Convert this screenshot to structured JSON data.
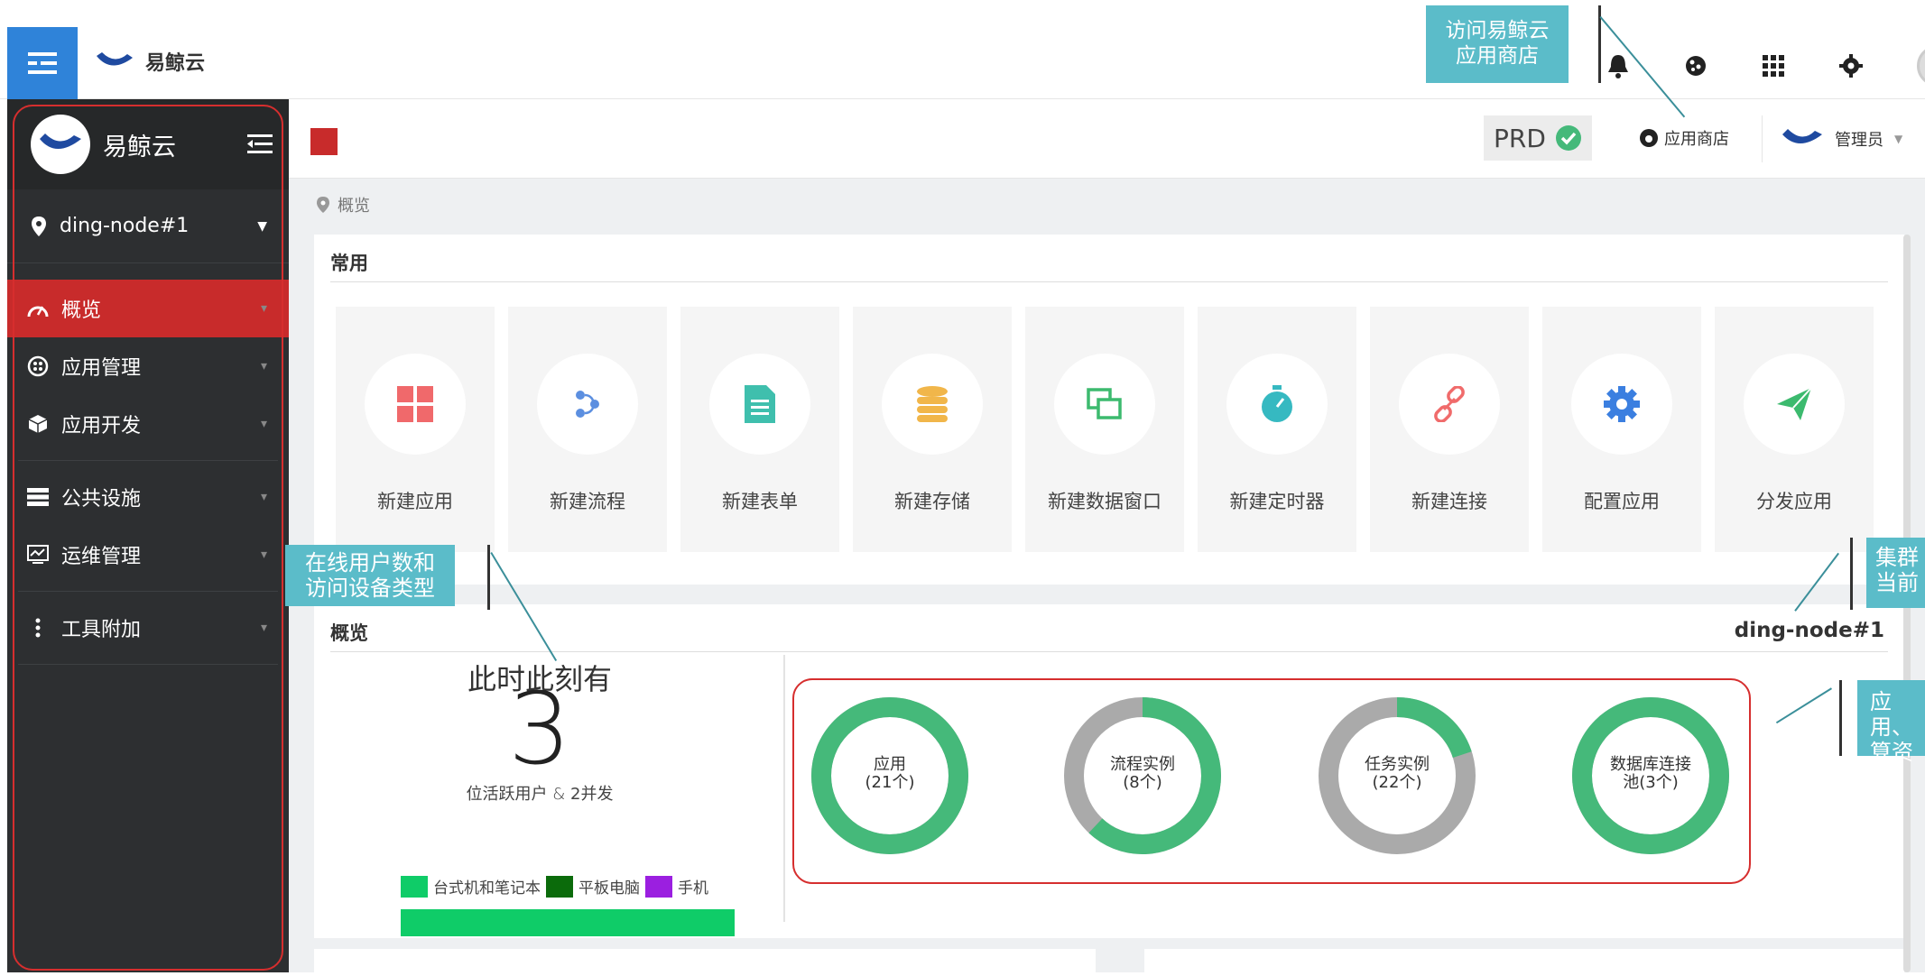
{
  "topbar": {
    "brand": "易鲸云",
    "icons": [
      "bell-icon",
      "cookie-icon",
      "grid-icon",
      "gear-icon",
      "user-avatar-icon"
    ]
  },
  "sidebar": {
    "logo_text": "易鲸云",
    "node": "ding-node#1",
    "items": [
      {
        "label": "概览",
        "icon": "dashboard-icon",
        "active": true
      },
      {
        "label": "应用管理",
        "icon": "apps-icon"
      },
      {
        "label": "应用开发",
        "icon": "cube-icon"
      },
      {
        "label": "公共设施",
        "icon": "list-icon"
      },
      {
        "label": "运维管理",
        "icon": "monitor-icon"
      },
      {
        "label": "工具附加",
        "icon": "more-icon"
      }
    ]
  },
  "header": {
    "env": "PRD",
    "store": "应用商店",
    "admin": "管理员"
  },
  "breadcrumb": "概览",
  "common": {
    "title": "常用",
    "tiles": [
      {
        "label": "新建应用",
        "icon": "windows-icon",
        "color": "#f0696b"
      },
      {
        "label": "新建流程",
        "icon": "flow-icon",
        "color": "#5c8fe0"
      },
      {
        "label": "新建表单",
        "icon": "form-icon",
        "color": "#3fbfad"
      },
      {
        "label": "新建存储",
        "icon": "database-icon",
        "color": "#f1b64a"
      },
      {
        "label": "新建数据窗口",
        "icon": "window-icon",
        "color": "#3cba6e"
      },
      {
        "label": "新建定时器",
        "icon": "timer-icon",
        "color": "#36b9c1"
      },
      {
        "label": "新建连接",
        "icon": "link-icon",
        "color": "#f06b6b"
      },
      {
        "label": "配置应用",
        "icon": "gear-icon",
        "color": "#3b7fe0"
      },
      {
        "label": "分发应用",
        "icon": "send-icon",
        "color": "#3cba6e"
      }
    ]
  },
  "overview": {
    "title": "概览",
    "node": "ding-node#1",
    "now_text": "此时此刻有",
    "active_users": "3",
    "users_label": "位活跃用户 & ",
    "concurrency": "2",
    "concurrency_suffix": "并发",
    "legend": [
      {
        "label": "台式机和笔记本",
        "color": "#0fcc68"
      },
      {
        "label": "平板电脑",
        "color": "#0b6b0b"
      },
      {
        "label": "手机",
        "color": "#9b1fe0"
      }
    ],
    "donuts": [
      {
        "line1": "应用",
        "line2": "(21个)",
        "fraction": 1.0
      },
      {
        "line1": "流程实例",
        "line2": "(8个)",
        "fraction": 0.62
      },
      {
        "line1": "任务实例",
        "line2": "(22个)",
        "fraction": 0.2
      },
      {
        "line1": "数据库连接",
        "line2": "池(3个)",
        "fraction": 1.0
      }
    ]
  },
  "annotations": {
    "store_callout": [
      "访问易鲸云",
      "应用商店"
    ],
    "users_callout": [
      "在线用户数和",
      "访问设备类型"
    ],
    "cluster_callout": [
      "集群",
      "当前"
    ],
    "resource_callout": [
      "应用、",
      "算资源"
    ]
  },
  "colors": {
    "accent_red": "#c82b2b",
    "green": "#45b97a",
    "gray": "#aaaaaa",
    "callout": "#5bbcc9"
  }
}
